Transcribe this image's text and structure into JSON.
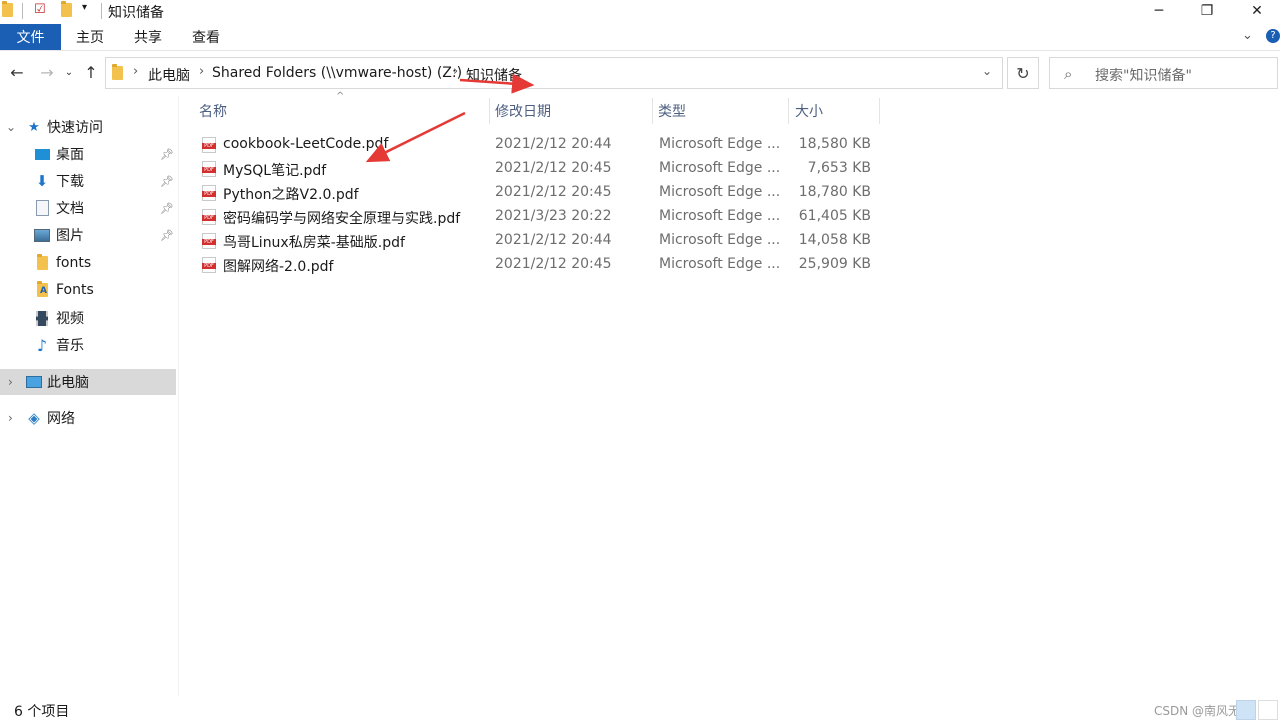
{
  "window": {
    "title": "知识储备"
  },
  "ribbon": {
    "tabs": [
      "文件",
      "主页",
      "共享",
      "查看"
    ]
  },
  "address": {
    "crumbs": [
      "此电脑",
      "Shared Folders (\\\\vmware-host) (Z:)",
      "知识储备"
    ]
  },
  "search": {
    "placeholder": "搜索\"知识储备\""
  },
  "sidebar": {
    "quick_access": "快速访问",
    "items": [
      {
        "label": "桌面",
        "icon": "desktop-icon",
        "pinned": true
      },
      {
        "label": "下载",
        "icon": "download-icon",
        "pinned": true
      },
      {
        "label": "文档",
        "icon": "document-icon",
        "pinned": true
      },
      {
        "label": "图片",
        "icon": "pictures-icon",
        "pinned": true
      },
      {
        "label": "fonts",
        "icon": "folder-icon",
        "pinned": false
      },
      {
        "label": "Fonts",
        "icon": "fonts-folder-icon",
        "pinned": false
      },
      {
        "label": "视频",
        "icon": "video-icon",
        "pinned": false
      },
      {
        "label": "音乐",
        "icon": "music-icon",
        "pinned": false
      }
    ],
    "this_pc": "此电脑",
    "network": "网络"
  },
  "columns": {
    "name": "名称",
    "date": "修改日期",
    "type": "类型",
    "size": "大小"
  },
  "files": [
    {
      "name": "cookbook-LeetCode.pdf",
      "date": "2021/2/12 20:44",
      "type": "Microsoft Edge ...",
      "size": "18,580 KB"
    },
    {
      "name": "MySQL笔记.pdf",
      "date": "2021/2/12 20:45",
      "type": "Microsoft Edge ...",
      "size": "7,653 KB"
    },
    {
      "name": "Python之路V2.0.pdf",
      "date": "2021/2/12 20:45",
      "type": "Microsoft Edge ...",
      "size": "18,780 KB"
    },
    {
      "name": "密码编码学与网络安全原理与实践.pdf",
      "date": "2021/3/23 20:22",
      "type": "Microsoft Edge ...",
      "size": "61,405 KB"
    },
    {
      "name": "鸟哥Linux私房菜-基础版.pdf",
      "date": "2021/2/12 20:44",
      "type": "Microsoft Edge ...",
      "size": "14,058 KB"
    },
    {
      "name": "图解网络-2.0.pdf",
      "date": "2021/2/12 20:45",
      "type": "Microsoft Edge ...",
      "size": "25,909 KB"
    }
  ],
  "status": {
    "count": "6 个项目",
    "watermark": "CSDN @南风无名"
  },
  "colors": {
    "accent": "#1a5fb4",
    "arrow": "#e53935"
  }
}
